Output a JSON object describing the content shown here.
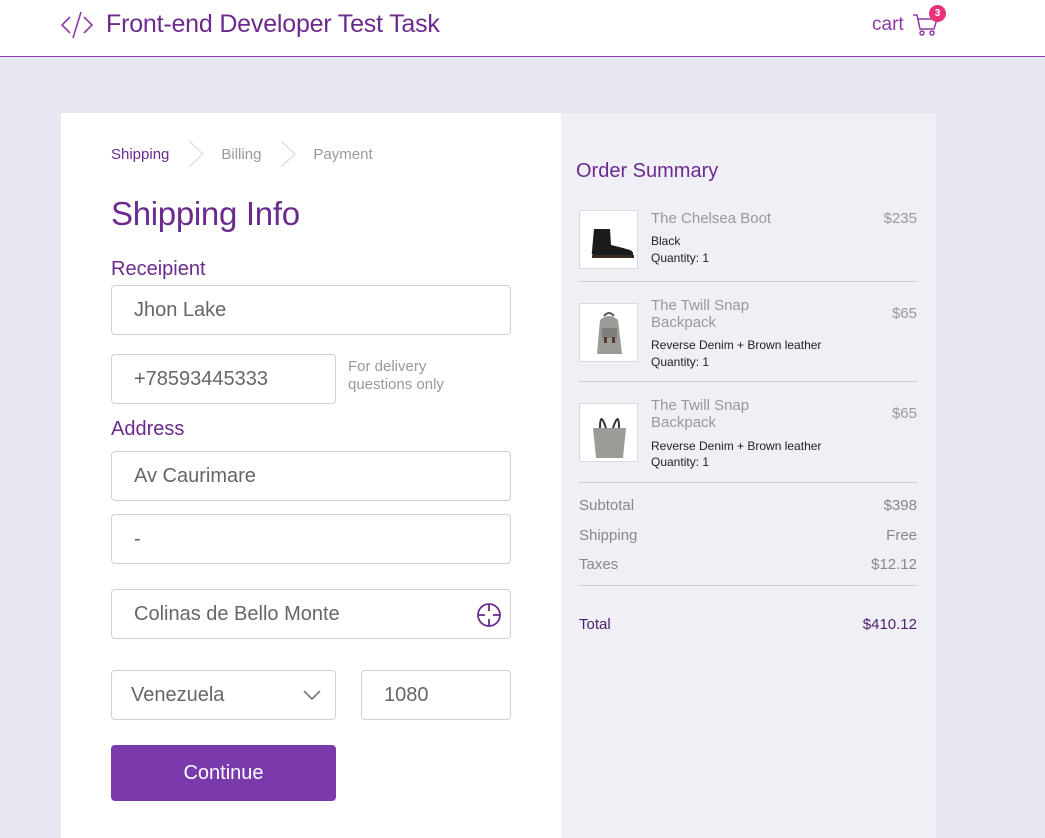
{
  "header": {
    "title": "Front-end Developer Test Task",
    "logo_icon": "code-brackets-icon",
    "cart_label": "cart",
    "cart_icon": "shopping-cart-icon",
    "cart_count": "3"
  },
  "steps": [
    {
      "label": "Shipping",
      "active": true
    },
    {
      "label": "Billing",
      "active": false
    },
    {
      "label": "Payment",
      "active": false
    }
  ],
  "form": {
    "heading": "Shipping Info",
    "recipient_label": "Receipient",
    "recipient_name": "Jhon Lake",
    "phone": "+78593445333",
    "phone_hint": "For delivery questions only",
    "address_label": "Address",
    "street": "Av Caurimare",
    "street2": "-",
    "city": "Colinas de Bello Monte",
    "country": "Venezuela",
    "zip": "1080",
    "continue_label": "Continue"
  },
  "summary": {
    "title": "Order Summary",
    "items": [
      {
        "name": "The Chelsea Boot",
        "price": "$235",
        "variant": "Black",
        "quantity": "Quantity: 1",
        "image": "boot-icon"
      },
      {
        "name": "The Twill Snap Backpack",
        "price": "$65",
        "variant": "Reverse Denim + Brown leather",
        "quantity": "Quantity: 1",
        "image": "backpack-icon"
      },
      {
        "name": "The Twill Snap Backpack",
        "price": "$65",
        "variant": "Reverse Denim + Brown leather",
        "quantity": "Quantity: 1",
        "image": "tote-bag-icon"
      }
    ],
    "subtotal_label": "Subtotal",
    "subtotal": "$398",
    "shipping_label": "Shipping",
    "shipping": "Free",
    "taxes_label": "Taxes",
    "taxes": "$12.12",
    "total_label": "Total",
    "total": "$410.12"
  },
  "colors": {
    "accent": "#6c2a8e",
    "button": "#7b3aab",
    "badge": "#e8337a",
    "page_bg": "#e6e7ef"
  }
}
